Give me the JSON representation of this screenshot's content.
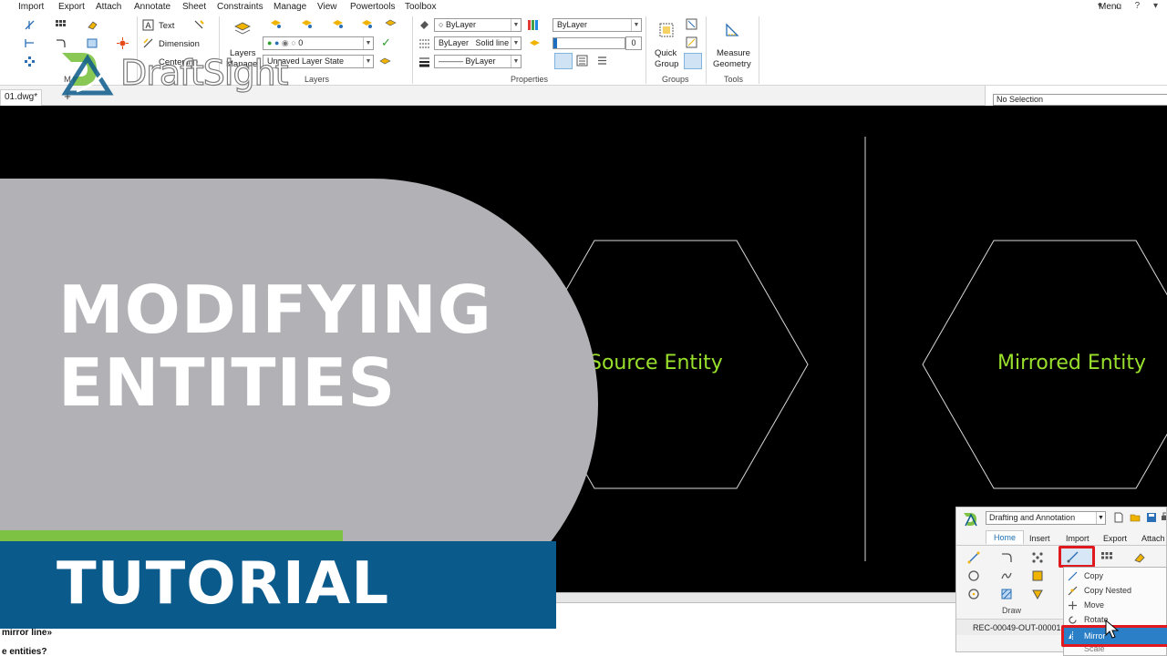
{
  "menubar": {
    "items": [
      "Import",
      "Export",
      "Attach",
      "Annotate",
      "Sheet",
      "Constraints",
      "Manage",
      "View",
      "Powertools",
      "Toolbox"
    ],
    "right_menu": "Menu",
    "right_icons": "▾ ⌂ ? ▾"
  },
  "ribbon": {
    "annotate": {
      "text": "Text",
      "dimension": "Dimension",
      "centerline": "Centerline"
    },
    "layers": {
      "manager_line1": "Layers",
      "manager_line2": "Manager",
      "layer_combo": "0",
      "layer_state": "Unsaved Layer State",
      "panel_label": "Layers"
    },
    "properties": {
      "color_combo": "ByLayer",
      "linestyle_layer": "ByLayer",
      "linestyle": "Solid line",
      "lineweight": "ByLayer",
      "layer_combo2": "ByLayer",
      "transparency_value": "0",
      "transparency_level": 0.0,
      "panel_label": "Properties"
    },
    "groups": {
      "quick_line1": "Quick",
      "quick_line2": "Group",
      "panel_label": "Groups"
    },
    "tools": {
      "measure_line1": "Measure",
      "measure_line2": "Geometry",
      "panel_label": "Tools"
    },
    "modify_panel_partial": "M"
  },
  "tabbar": {
    "doc_tab": "01.dwg*",
    "new_tab": "+",
    "selection": "No Selection"
  },
  "canvas": {
    "source_label": "Source Entity",
    "mirrored_label": "Mirrored Entity",
    "line_color": "#d8d8d8",
    "label_color": "#99e02d",
    "background": "#000000"
  },
  "cmdline": {
    "line1": "mirror line»",
    "line2": "e entities?"
  },
  "overlay": {
    "title_line1": "MODIFYING",
    "title_line2": "ENTITIES",
    "tutorial": "TUTORIAL",
    "gray_color": "#b1b1b6",
    "green_color": "#7dc242",
    "blue_color": "#0b5a8c"
  },
  "logo": {
    "text": "DraftSight",
    "mark": "DS"
  },
  "inset": {
    "workspace": "Drafting and Annotation",
    "tabs": [
      "Home",
      "Insert",
      "Import",
      "Export",
      "Attach"
    ],
    "active_tab": "Home",
    "draw_label": "Draw",
    "recording": "REC-00049-OUT-00001.",
    "dropdown": [
      "Copy",
      "Copy Nested",
      "Move",
      "Rotate",
      "Mirror",
      "Scale"
    ],
    "highlight_color": "#e0191f"
  }
}
